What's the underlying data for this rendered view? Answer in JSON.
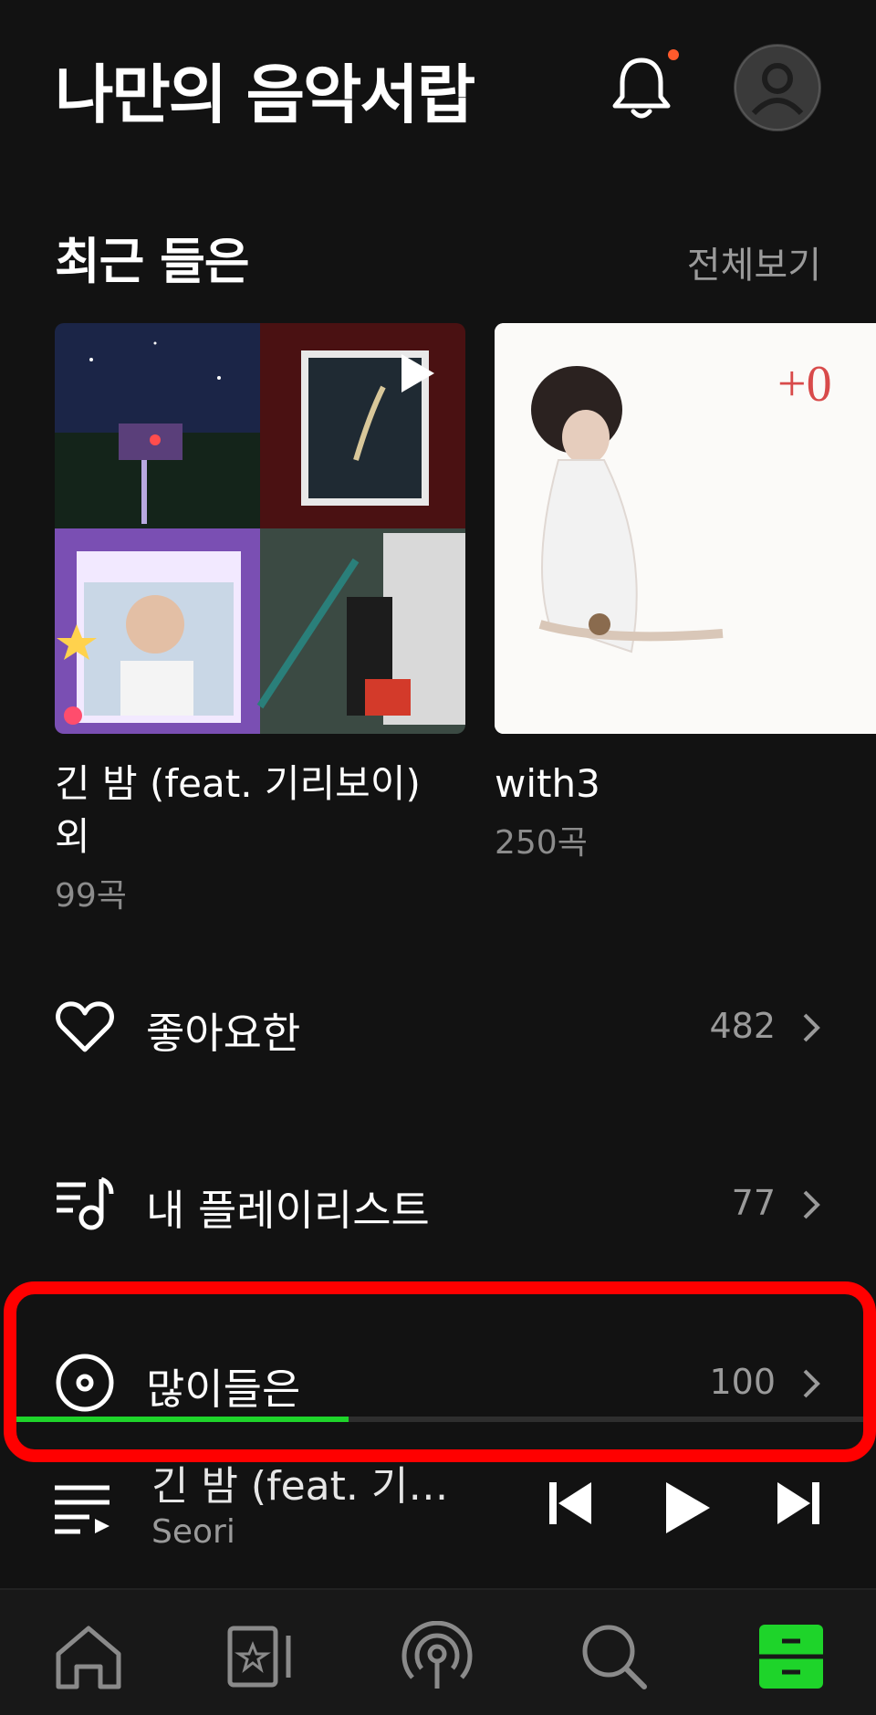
{
  "header": {
    "title": "나만의 음악서랍",
    "notification_icon": "bell-icon",
    "has_unread": true,
    "avatar_icon": "user-avatar-icon"
  },
  "recent": {
    "title": "최근 들은",
    "see_all": "전체보기",
    "items": [
      {
        "title": "긴 밤 (feat. 기리보이)\n 외",
        "count": "99곡",
        "cover_icon": "collage-cover"
      },
      {
        "title": "with3",
        "count": "250곡",
        "cover_icon": "album-cover"
      }
    ]
  },
  "menu": [
    {
      "label": "좋아요한",
      "count": "482",
      "icon": "heart-icon"
    },
    {
      "label": "내 플레이리스트",
      "count": "77",
      "icon": "playlist-music-icon"
    },
    {
      "label": "많이들은",
      "count": "100",
      "icon": "disc-icon"
    }
  ],
  "player": {
    "title": "긴 밤 (feat. 기리보이)",
    "artist": "Seori",
    "progress_fraction": 0.39
  },
  "tabs": [
    {
      "name": "home",
      "icon": "home-icon"
    },
    {
      "name": "favorites",
      "icon": "star-card-icon"
    },
    {
      "name": "podcast",
      "icon": "podcast-icon"
    },
    {
      "name": "search",
      "icon": "search-icon"
    },
    {
      "name": "library",
      "icon": "drawer-icon",
      "active": true
    }
  ],
  "colors": {
    "background": "#121212",
    "accent_green": "#1ed42a",
    "highlight_red": "#ff0000",
    "notification_dot": "#ff5a2c"
  }
}
